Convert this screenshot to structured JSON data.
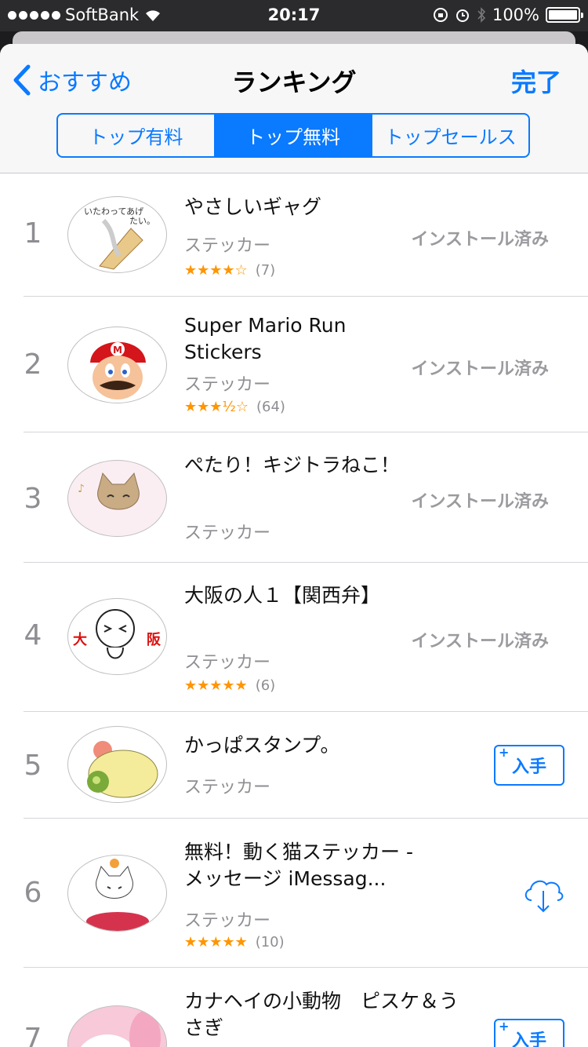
{
  "status_bar": {
    "carrier": "SoftBank",
    "time": "20:17",
    "battery": "100%"
  },
  "nav": {
    "back_label": "おすすめ",
    "title": "ランキング",
    "done_label": "完了"
  },
  "segments": [
    "トップ有料",
    "トップ無料",
    "トップセールス"
  ],
  "active_segment": 1,
  "items": [
    {
      "rank": "1",
      "name": "やさしいギャグ",
      "category": "ステッカー",
      "stars": "★★★★☆",
      "count": "(7)",
      "action": "インストール済み"
    },
    {
      "rank": "2",
      "name": "Super Mario Run Stickers",
      "category": "ステッカー",
      "stars": "★★★½☆",
      "count": "(64)",
      "action": "インストール済み"
    },
    {
      "rank": "3",
      "name": "ぺたり！キジトラねこ！",
      "category": "ステッカー",
      "action": "インストール済み"
    },
    {
      "rank": "4",
      "name": "大阪の人１【関西弁】",
      "category": "ステッカー",
      "stars": "★★★★★",
      "count": "(6)",
      "action": "インストール済み"
    },
    {
      "rank": "5",
      "name": "かっぱスタンプ。",
      "category": "ステッカー",
      "action": "入手"
    },
    {
      "rank": "6",
      "name": "無料！動く猫ステッカー - メッセージ iMessag...",
      "category": "ステッカー",
      "stars": "★★★★★",
      "count": "(10)"
    },
    {
      "rank": "7",
      "name": "カナヘイの小動物　ピスケ＆うさぎ",
      "action": "入手"
    }
  ]
}
